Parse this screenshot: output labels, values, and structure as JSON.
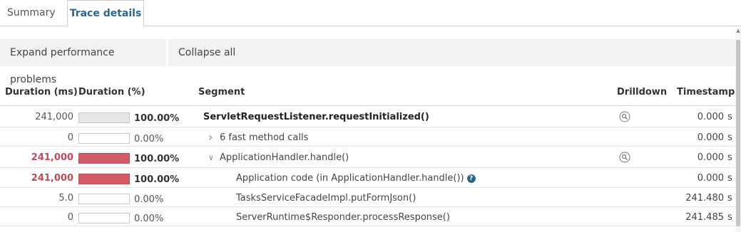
{
  "tabs": [
    {
      "label": "Summary",
      "active": false
    },
    {
      "label": "Trace details",
      "active": true
    }
  ],
  "toolbar": {
    "expand_label": "Expand performance problems",
    "collapse_label": "Collapse all"
  },
  "columns": {
    "duration_ms": "Duration (ms)",
    "duration_pct": "Duration (%)",
    "segment": "Segment",
    "drilldown": "Drilldown",
    "timestamp": "Timestamp"
  },
  "rows": [
    {
      "ms": "241,000",
      "pct": "100.00%",
      "bar_fraction": 1.0,
      "segment": "ServletRequestListener.requestInitialized()",
      "timestamp": "0.000",
      "unit": "s",
      "hot": false,
      "bold": true,
      "drilldown": true,
      "indent": 0,
      "chevron": "",
      "info": false
    },
    {
      "ms": "0",
      "pct": "0.00%",
      "bar_fraction": 0.0,
      "segment": "6 fast method calls",
      "timestamp": "0.000",
      "unit": "s",
      "hot": false,
      "bold": false,
      "drilldown": false,
      "indent": 1,
      "chevron": "right",
      "info": false
    },
    {
      "ms": "241,000",
      "pct": "100.00%",
      "bar_fraction": 1.0,
      "segment": "ApplicationHandler.handle()",
      "timestamp": "0.000",
      "unit": "s",
      "hot": true,
      "bold": false,
      "drilldown": true,
      "indent": 1,
      "chevron": "down",
      "info": false
    },
    {
      "ms": "241,000",
      "pct": "100.00%",
      "bar_fraction": 1.0,
      "segment": "Application code (in ApplicationHandler.handle())",
      "timestamp": "0.000",
      "unit": "s",
      "hot": true,
      "bold": false,
      "drilldown": false,
      "indent": 2,
      "chevron": "",
      "info": true
    },
    {
      "ms": "5.0",
      "pct": "0.00%",
      "bar_fraction": 0.0,
      "segment": "TasksServiceFacadeImpl.putFormJson()",
      "timestamp": "241.480",
      "unit": "s",
      "hot": false,
      "bold": false,
      "drilldown": false,
      "indent": 2,
      "chevron": "",
      "info": false
    },
    {
      "ms": "0",
      "pct": "0.00%",
      "bar_fraction": 0.0,
      "segment": "ServerRuntime$Responder.processResponse()",
      "timestamp": "241.485",
      "unit": "s",
      "hot": false,
      "bold": false,
      "drilldown": false,
      "indent": 2,
      "chevron": "",
      "info": false
    }
  ],
  "colors": {
    "accent": "#2b6690",
    "hot": "#d35b68",
    "hot_text": "#c24a58"
  }
}
